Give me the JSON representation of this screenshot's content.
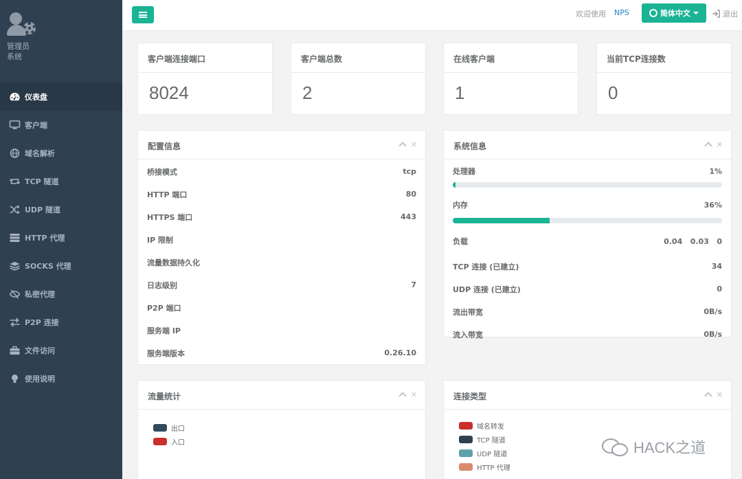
{
  "sidebar": {
    "profile": {
      "name": "管理员",
      "role": "系统"
    },
    "items": [
      {
        "label": "仪表盘",
        "icon": "dashboard-icon",
        "active": true
      },
      {
        "label": "客户端",
        "icon": "desktop-icon"
      },
      {
        "label": "域名解析",
        "icon": "globe-icon"
      },
      {
        "label": "TCP 隧道",
        "icon": "retweet-icon"
      },
      {
        "label": "UDP 隧道",
        "icon": "random-icon"
      },
      {
        "label": "HTTP 代理",
        "icon": "server-icon"
      },
      {
        "label": "SOCKS 代理",
        "icon": "layers-icon"
      },
      {
        "label": "私密代理",
        "icon": "eye-slash-icon"
      },
      {
        "label": "P2P 连接",
        "icon": "exchange-icon"
      },
      {
        "label": "文件访问",
        "icon": "briefcase-icon"
      },
      {
        "label": "使用说明",
        "icon": "lightbulb-icon"
      }
    ]
  },
  "topbar": {
    "welcome": "欢迎使用",
    "brand": "NPS",
    "language": "简体中文",
    "logout": "退出"
  },
  "stats": [
    {
      "title": "客户端连接端口",
      "value": "8024"
    },
    {
      "title": "客户端总数",
      "value": "2"
    },
    {
      "title": "在线客户端",
      "value": "1"
    },
    {
      "title": "当前TCP连接数",
      "value": "0"
    }
  ],
  "config": {
    "title": "配置信息",
    "rows": [
      {
        "label": "桥接模式",
        "value": "tcp"
      },
      {
        "label": "HTTP 端口",
        "value": "80"
      },
      {
        "label": "HTTPS 端口",
        "value": "443"
      },
      {
        "label": "IP 限制",
        "value": ""
      },
      {
        "label": "流量数据持久化",
        "value": ""
      },
      {
        "label": "日志级别",
        "value": "7"
      },
      {
        "label": "P2P 端口",
        "value": ""
      },
      {
        "label": "服务端 IP",
        "value": ""
      },
      {
        "label": "服务端版本",
        "value": "0.26.10"
      }
    ]
  },
  "system": {
    "title": "系统信息",
    "cpu": {
      "label": "处理器",
      "value": "1%",
      "fraction": 0.01
    },
    "memory": {
      "label": "内存",
      "value": "36%",
      "fraction": 0.36
    },
    "load": {
      "label": "负载",
      "value": "0.04   0.03   0"
    },
    "rows": [
      {
        "label": "TCP 连接 (已建立)",
        "value": "34"
      },
      {
        "label": "UDP 连接 (已建立)",
        "value": "0"
      },
      {
        "label": "流出带宽",
        "value": "0B/s"
      },
      {
        "label": "流入带宽",
        "value": "0B/s"
      }
    ]
  },
  "traffic": {
    "title": "流量统计",
    "legend": [
      {
        "label": "出口",
        "color": "#34495e"
      },
      {
        "label": "入口",
        "color": "#c9302c"
      }
    ]
  },
  "conntype": {
    "title": "连接类型",
    "legend": [
      {
        "label": "域名转发",
        "color": "#c9302c"
      },
      {
        "label": "TCP 隧道",
        "color": "#2f4050"
      },
      {
        "label": "UDP 隧道",
        "color": "#5fa2a8"
      },
      {
        "label": "HTTP 代理",
        "color": "#d98b6d"
      }
    ]
  },
  "watermark": "HACK之道",
  "colors": {
    "accent": "#1ab394",
    "sidebar": "#2f4050",
    "link": "#1c84c6"
  }
}
